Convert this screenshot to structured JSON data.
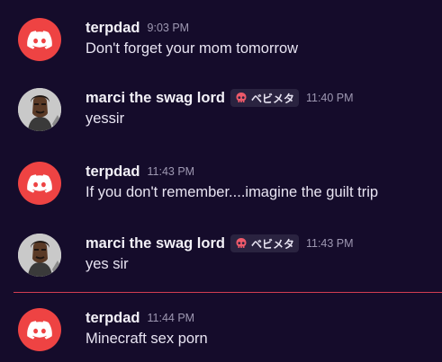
{
  "messages": [
    {
      "author": "terpdad",
      "time": "9:03 PM",
      "text": "Don't forget your mom tomorrow",
      "avatar_icon": "discord-logo-icon"
    },
    {
      "author": "marci the swag lord",
      "tag": "ベビメタ",
      "time": "11:40 PM",
      "text": "yessir",
      "avatar_icon": "user-avatar"
    },
    {
      "author": "terpdad",
      "time": "11:43 PM",
      "text": "If you don't  remember....imagine the guilt trip",
      "avatar_icon": "discord-logo-icon"
    },
    {
      "author": "marci the swag lord",
      "tag": "ベビメタ",
      "time": "11:43 PM",
      "text": "yes sir",
      "avatar_icon": "user-avatar"
    },
    {
      "author": "terpdad",
      "time": "11:44 PM",
      "text": "Minecraft sex porn",
      "avatar_icon": "discord-logo-icon"
    }
  ],
  "colors": {
    "background": "#150c2b",
    "discord_avatar": "#ee4343",
    "new_message_divider": "#d33d52",
    "timestamp": "#9e98b2"
  }
}
